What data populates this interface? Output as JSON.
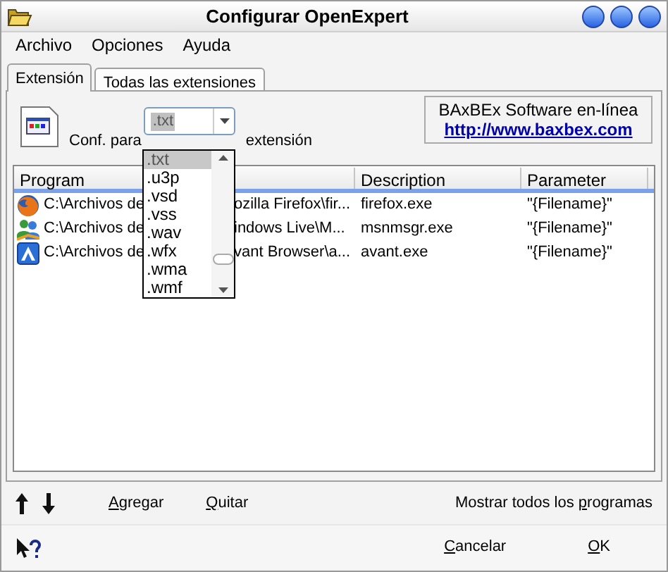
{
  "window": {
    "title": "Configurar OpenExpert"
  },
  "menu": [
    {
      "label": "Archivo"
    },
    {
      "label": "Opciones"
    },
    {
      "label": "Ayuda"
    }
  ],
  "tabs": [
    {
      "label": "Extensión",
      "selected": true
    },
    {
      "label": "Todas las extensiones",
      "selected": false
    }
  ],
  "config": {
    "label_before": "Conf. para",
    "extension": {
      "value": ".txt",
      "expanded": true
    },
    "label_after": "extensión"
  },
  "dropdown_options": [
    {
      "label": ".txt",
      "selected": true
    },
    {
      "label": ".u3p",
      "selected": false
    },
    {
      "label": ".vsd",
      "selected": false
    },
    {
      "label": ".vss",
      "selected": false
    },
    {
      "label": ".wav",
      "selected": false
    },
    {
      "label": ".wfx",
      "selected": false
    },
    {
      "label": ".wma",
      "selected": false
    },
    {
      "label": ".wmf",
      "selected": false
    }
  ],
  "info": {
    "text": "BAxBEx Software en-línea",
    "link": "http://www.baxbex.com"
  },
  "table": {
    "columns": [
      "Program",
      "Description",
      "Parameter"
    ],
    "rows": [
      {
        "kind": "firefox",
        "program_start": "C:\\Archivos de",
        "program_end": "ozilla Firefox\\fir...",
        "description": "firefox.exe",
        "parameter": "\"{Filename}\""
      },
      {
        "kind": "messenger",
        "program_start": "C:\\Archivos de",
        "program_end": "indows Live\\M...",
        "description": "msnmsgr.exe",
        "parameter": "\"{Filename}\""
      },
      {
        "kind": "avant",
        "program_start": "C:\\Archivos de",
        "program_end": "vant Browser\\a...",
        "description": "avant.exe",
        "parameter": "\"{Filename}\""
      }
    ]
  },
  "actions": [
    {
      "key": "A",
      "after": "gregar"
    },
    {
      "key": "Q",
      "after": "uitar"
    },
    {
      "before": "Mostrar todos los ",
      "key": "p",
      "after": "rogramas"
    }
  ],
  "buttons": [
    {
      "key": "C",
      "after": "ancelar"
    },
    {
      "key": "O",
      "after": "K"
    }
  ]
}
